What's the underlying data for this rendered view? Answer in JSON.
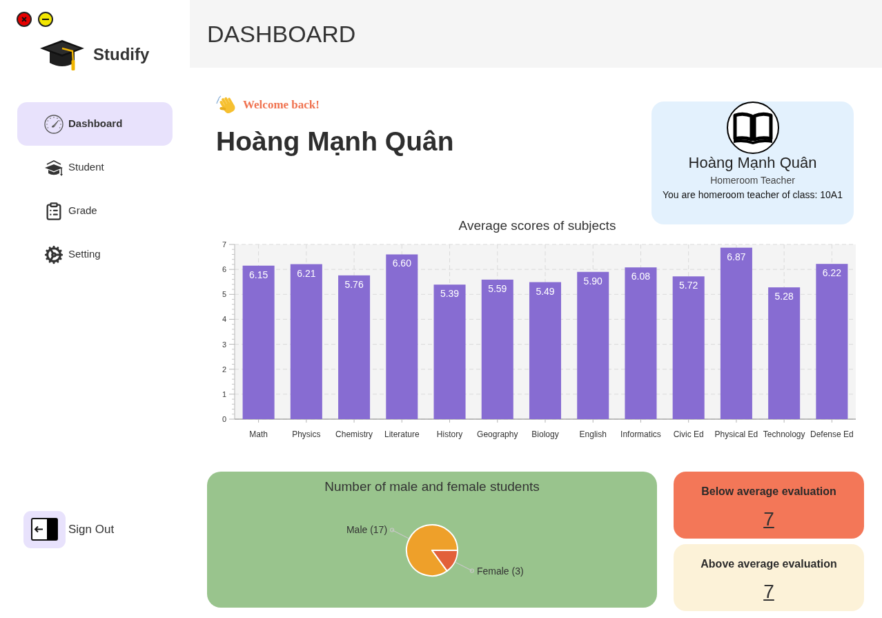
{
  "app": {
    "name": "Studify"
  },
  "sidebar": {
    "items": [
      {
        "label": "Dashboard",
        "selected": true
      },
      {
        "label": "Student",
        "selected": false
      },
      {
        "label": "Grade",
        "selected": false
      },
      {
        "label": "Setting",
        "selected": false
      }
    ],
    "sign_out": {
      "label": "Sign Out"
    }
  },
  "header": {
    "title": "DASHBOARD"
  },
  "welcome": {
    "greeting": "Welcome back!",
    "name": "Hoàng Mạnh Quân"
  },
  "profile_card": {
    "name": "Hoàng Mạnh Quân",
    "role": "Homeroom Teacher",
    "class_info": "You are homeroom teacher of class: 10A1"
  },
  "scores_chart": {
    "chart_data": {
      "type": "bar",
      "title": "Average scores of subjects",
      "categories": [
        "Math",
        "Physics",
        "Chemistry",
        "Literature",
        "History",
        "Geography",
        "Biology",
        "English",
        "Informatics",
        "Civic Ed",
        "Physical Ed",
        "Technology",
        "Defense Ed"
      ],
      "values": [
        6.15,
        6.21,
        5.76,
        6.6,
        5.39,
        5.59,
        5.49,
        5.9,
        6.08,
        5.72,
        6.87,
        5.28,
        6.22
      ],
      "value_labels": [
        "6.15",
        "6.21",
        "5.76",
        "6.60",
        "5.39",
        "5.59",
        "5.49",
        "5.90",
        "6.08",
        "5.72",
        "6.87",
        "5.28",
        "6.22"
      ],
      "color": "#876cd2",
      "ylim": [
        0,
        7
      ],
      "yticks": [
        0,
        1,
        2,
        3,
        4,
        5,
        6,
        7
      ],
      "grid": true
    }
  },
  "gender_card": {
    "chart_data": {
      "type": "pie",
      "title": "Number of male and female students",
      "categories": [
        "Male (17)",
        "Female (3)"
      ],
      "values": [
        17,
        3
      ],
      "colors": [
        "#eea02a",
        "#e2603a"
      ]
    }
  },
  "evaluation_cards": [
    {
      "label": "Below average evaluation",
      "value": "7",
      "color": "#f37758"
    },
    {
      "label": "Above average evaluation",
      "value": "7",
      "color": "#fcf2d8"
    }
  ]
}
